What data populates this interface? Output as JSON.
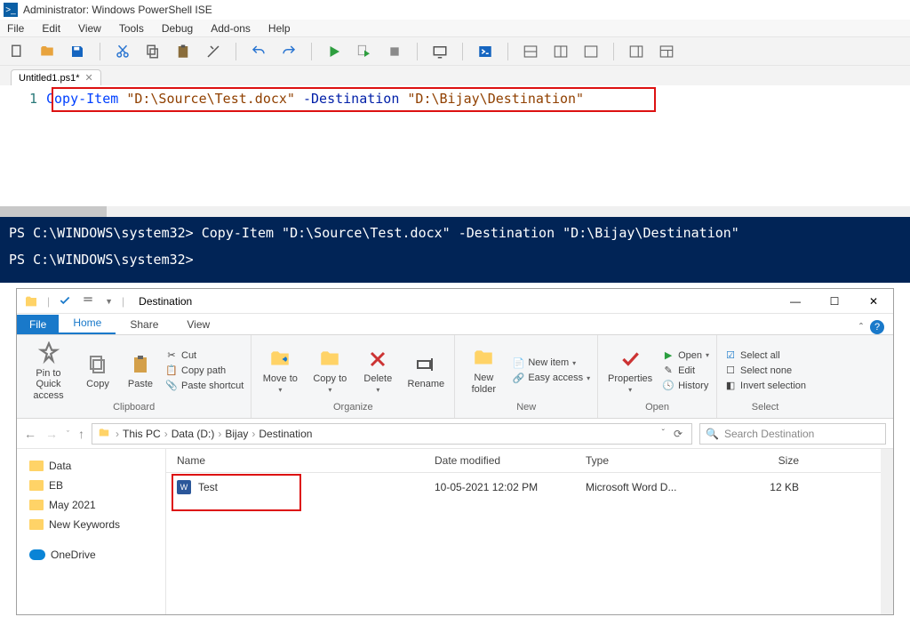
{
  "ise": {
    "title": "Administrator: Windows PowerShell ISE",
    "menus": [
      "File",
      "Edit",
      "View",
      "Tools",
      "Debug",
      "Add-ons",
      "Help"
    ],
    "tab": "Untitled1.ps1*",
    "line_no": "1",
    "code": {
      "cmd": "Copy-Item",
      "str1": "\"D:\\Source\\Test.docx\"",
      "param": "-Destination",
      "str2": "\"D:\\Bijay\\Destination\""
    },
    "console": {
      "line1_prompt": "PS C:\\WINDOWS\\system32>",
      "line1_cmd": "Copy-Item \"D:\\Source\\Test.docx\" -Destination \"D:\\Bijay\\Destination\"",
      "line2_prompt": "PS C:\\WINDOWS\\system32>"
    }
  },
  "explorer": {
    "title": "Destination",
    "tabs": {
      "file": "File",
      "home": "Home",
      "share": "Share",
      "view": "View"
    },
    "ribbon": {
      "clipboard": {
        "label": "Clipboard",
        "pin": "Pin to Quick access",
        "copy": "Copy",
        "paste": "Paste",
        "cut": "Cut",
        "copy_path": "Copy path",
        "paste_shortcut": "Paste shortcut"
      },
      "organize": {
        "label": "Organize",
        "move": "Move to",
        "copy": "Copy to",
        "delete": "Delete",
        "rename": "Rename"
      },
      "new": {
        "label": "New",
        "new_folder": "New folder",
        "new_item": "New item",
        "easy_access": "Easy access"
      },
      "open": {
        "label": "Open",
        "properties": "Properties",
        "open": "Open",
        "edit": "Edit",
        "history": "History"
      },
      "select": {
        "label": "Select",
        "all": "Select all",
        "none": "Select none",
        "invert": "Invert selection"
      }
    },
    "breadcrumb": [
      "This PC",
      "Data (D:)",
      "Bijay",
      "Destination"
    ],
    "search_placeholder": "Search Destination",
    "tree": [
      "Data",
      "EB",
      "May 2021",
      "New Keywords"
    ],
    "tree_onedrive": "OneDrive",
    "columns": {
      "name": "Name",
      "date": "Date modified",
      "type": "Type",
      "size": "Size"
    },
    "file": {
      "name": "Test",
      "date": "10-05-2021 12:02 PM",
      "type": "Microsoft Word D...",
      "size": "12 KB"
    }
  }
}
